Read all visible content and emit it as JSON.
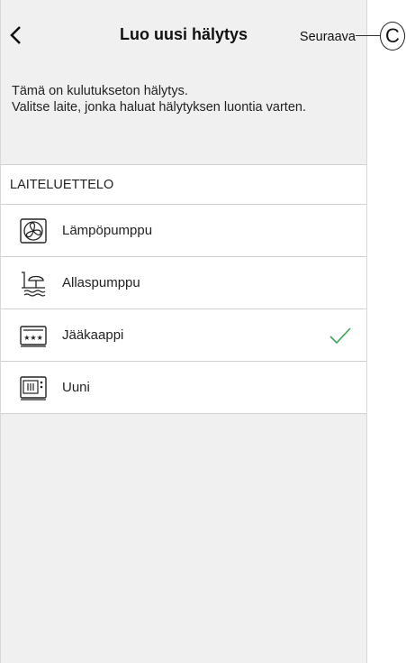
{
  "header": {
    "title": "Luo uusi hälytys",
    "next_label": "Seuraava"
  },
  "description": {
    "line1": "Tämä on kulutukseton hälytys.",
    "line2": "Valitse laite, jonka haluat hälytyksen luontia varten."
  },
  "device_list": {
    "header": "LAITELUETTELO",
    "items": [
      {
        "label": "Lämpöpumppu",
        "icon": "heat-pump-icon",
        "selected": false
      },
      {
        "label": "Allaspumppu",
        "icon": "pool-pump-icon",
        "selected": false
      },
      {
        "label": "Jääkaappi",
        "icon": "fridge-icon",
        "selected": true
      },
      {
        "label": "Uuni",
        "icon": "oven-icon",
        "selected": false
      }
    ]
  },
  "callout": {
    "letter": "C"
  },
  "colors": {
    "check": "#3aa655",
    "background": "#f0f0f0"
  }
}
